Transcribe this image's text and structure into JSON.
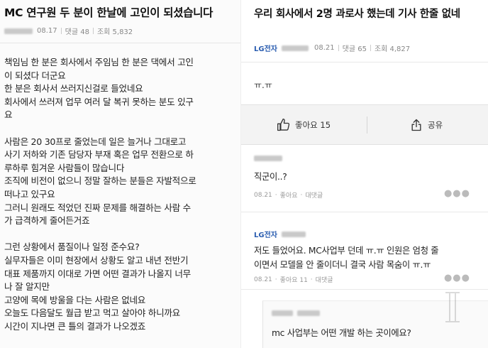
{
  "left_post": {
    "title": "MC 연구원 두 분이 한날에 고인이 되셨습니다",
    "date": "08.17",
    "comments": "댓글 48",
    "views": "조회 5,832",
    "body_lines": [
      "책임님 한 분은 회사에서 주임님 한 분은 댁에서 고인",
      "이 되셨다 더군요",
      "한 분은 회사서 쓰러지신걸로 들었네요",
      "회사에서 쓰러져 업무 여러 달 복귀 못하는 분도 있구",
      "요",
      "",
      "사람은 20 30프로 줄었는데 일은 늘거나 그대로고",
      "사기 저하와 기존 담당자 부재 혹은 업무 전환으로 하",
      "루하루 힘겨운 사람들이 많습니다",
      "조직에 비전이 없으니 정말 잘하는 분들은 자발적으로",
      "떠나고 있구요",
      "그러니 원래도 적었던 진짜 문제를 해결하는 사람 수",
      "가 급격하게 줄어든거죠",
      "",
      "그런 상황에서 품질이나 일정 준수요?",
      "실무자들은 이미 현장에서 상황도 알고 내년 전반기",
      "대표 제품까지 이대로 가면 어떤 결과가 나올지 너무",
      "나 잘 알지만",
      "고양에 목에 방울을 다는 사람은 없네요",
      "오늘도 다음달도 월급 받고 먹고 살아야 하니까요",
      "시간이 지나면 큰 틀의 결과가 나오겠죠"
    ]
  },
  "right_post": {
    "title": "우리 회사에서 2명 과로사 했는데 기사 한줄 없네",
    "company": "LG전자",
    "date": "08.21",
    "comments": "댓글 65",
    "views": "조회 4,827",
    "content": "ㅠ.ㅠ",
    "like_label": "좋아요 15",
    "share_label": "공유"
  },
  "comments": [
    {
      "text": "직군이..?",
      "date": "08.21",
      "like": "좋아요",
      "reply": "대댓글"
    },
    {
      "company": "LG전자",
      "text_lines": [
        "저도 들었어요. MC사업부 던데 ㅠ.ㅠ 인원은 엄청 줄",
        "이면서 모델을 안 줄이더니 결국 사람 목숨이 ㅠ.ㅠ"
      ],
      "date": "08.21",
      "like": "좋아요 11",
      "reply": "대댓글"
    }
  ],
  "reply": {
    "text": "mc 사업부는 어떤 개발 하는 곳이에요?"
  },
  "icons": {
    "like": "thumbs-up-icon",
    "share": "share-icon",
    "more": "more-dots-icon"
  },
  "colors": {
    "brand": "#2a5db0",
    "action_bar": "#f3f3f3"
  }
}
